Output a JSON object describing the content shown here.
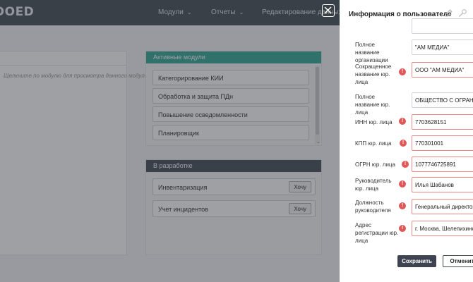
{
  "app": {
    "logo": "DOED"
  },
  "nav": [
    {
      "label": "Модули"
    },
    {
      "label": "Отчеты"
    },
    {
      "label": "Редактирование данных"
    }
  ],
  "left_card": {
    "hint": "Щелкните по модулю для просмотра данного модуля"
  },
  "active_modules": {
    "header": "Активные модули",
    "items": [
      {
        "label": "Категорирование КИИ"
      },
      {
        "label": "Обработка и защита ПДн"
      },
      {
        "label": "Повышение осведомленности"
      },
      {
        "label": "Планировщик"
      }
    ]
  },
  "dev_modules": {
    "header": "В разработке",
    "items": [
      {
        "label": "Инвентаризация",
        "button": "Хочу"
      },
      {
        "label": "Учет инцидентов",
        "button": "Хочу"
      }
    ]
  },
  "drawer": {
    "title": "Информация о пользователе",
    "icons": [
      "edit-icon",
      "settings-icon"
    ],
    "fields": [
      {
        "label": "Полное название организации",
        "value": "\"АМ МЕДИА\"",
        "warn": false
      },
      {
        "label": "Сокращенное название юр. лица",
        "value": "ООО \"АМ МЕДИА\"",
        "warn": true
      },
      {
        "label": "Полное название юр. лица",
        "value": "ОБЩЕСТВО С ОГРАНИЧЕННОЙ",
        "warn": false
      },
      {
        "label": "ИНН юр. лица",
        "value": "7703628151",
        "warn": true
      },
      {
        "label": "КПП юр. лица",
        "value": "770301001",
        "warn": true
      },
      {
        "label": "ОГРН юр. лица",
        "value": "1077746725891",
        "warn": true
      },
      {
        "label": "Руководитель юр. лица",
        "value": "Илья Шабанов",
        "warn": true
      },
      {
        "label": "Должность руководителя",
        "value": "Генеральный директор",
        "warn": true
      },
      {
        "label": "Адрес регистрации юр. лица",
        "value": "г. Москва, Шелепихинская",
        "warn": true
      }
    ],
    "save_label": "Сохранить",
    "cancel_label": "Отменить"
  },
  "colors": {
    "topbar": "#4a505a",
    "accent": "#3aa99c",
    "warning": "#e05757",
    "button_dark": "#3d4350"
  }
}
